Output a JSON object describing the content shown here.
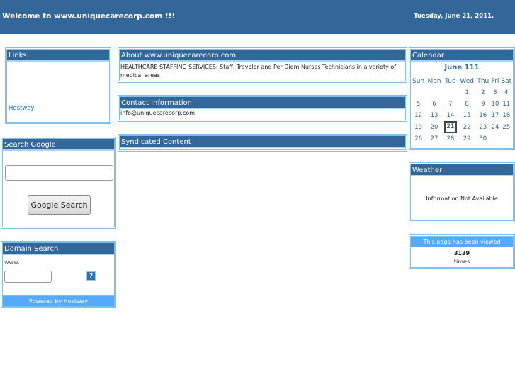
{
  "header": {
    "title": "Welcome to www.uniquecarecorp.com !!!",
    "date": "Tuesday, June 21, 2011."
  },
  "links": {
    "title": "Links",
    "items": [
      "Hostway"
    ]
  },
  "search_google": {
    "title": "Search Google",
    "input_value": "",
    "button": "Google Search"
  },
  "domain_search": {
    "title": "Domain Search",
    "prefix": "www.",
    "input_value": "",
    "help_icon": "?",
    "powered": "Powered by Hostway"
  },
  "about": {
    "title": "About www.uniquecarecorp.com",
    "text": "HEALTHCARE STAFFING SERVICES: Staff, Traveler and Per Diem Nurses Technicians in a variety of medical areas"
  },
  "contact": {
    "title": "Contact Information",
    "text": "info@uniquecarecorp.com"
  },
  "syndicated": {
    "title": "Syndicated Content"
  },
  "calendar": {
    "title": "Calendar",
    "month": "June 111",
    "days": [
      "Sun",
      "Mon",
      "Tue",
      "Wed",
      "Thu",
      "Fri",
      "Sat"
    ],
    "weeks": [
      [
        "",
        "",
        "",
        "1",
        "2",
        "3",
        "4"
      ],
      [
        "5",
        "6",
        "7",
        "8",
        "9",
        "10",
        "11"
      ],
      [
        "12",
        "13",
        "14",
        "15",
        "16",
        "17",
        "18"
      ],
      [
        "19",
        "20",
        "21",
        "22",
        "23",
        "24",
        "25"
      ],
      [
        "26",
        "27",
        "28",
        "29",
        "30",
        "",
        ""
      ]
    ],
    "today": "21"
  },
  "weather": {
    "title": "Weather",
    "text": "Information Not Available"
  },
  "counter": {
    "title": "This page has been viewed",
    "count": "3139",
    "suffix": "times"
  },
  "colors": {
    "header": "#336699",
    "border": "#7ec0e8",
    "accent": "#55aaff"
  }
}
